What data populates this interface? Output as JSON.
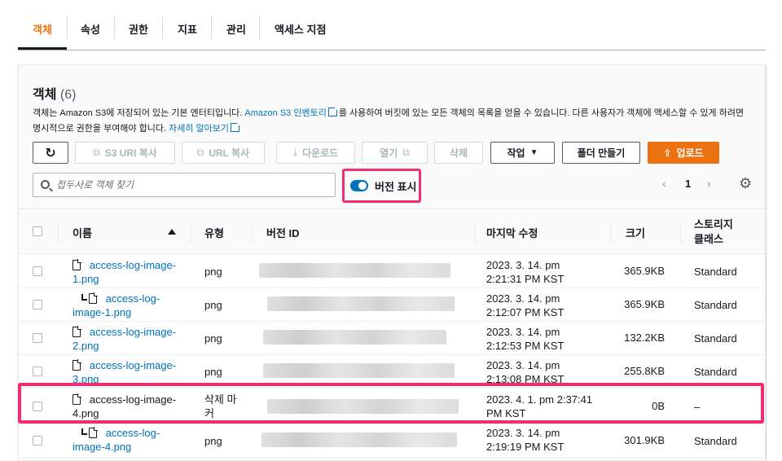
{
  "tabs": [
    {
      "label": "객체",
      "active": true
    },
    {
      "label": "속성",
      "active": false
    },
    {
      "label": "권한",
      "active": false
    },
    {
      "label": "지표",
      "active": false
    },
    {
      "label": "관리",
      "active": false
    },
    {
      "label": "액세스 지점",
      "active": false
    }
  ],
  "panel": {
    "title": "객체",
    "count": "(6)",
    "desc_part1": "객체는 Amazon S3에 저장되어 있는 기본 엔터티입니다. ",
    "desc_link1": "Amazon S3 인벤토리",
    "desc_part2": "를 사용하여 버킷에 있는 모든 객체의 목록을 얻을 수 있습니다. 다른 사용자가 객체에 액세스할 수 있게 하려면 명시적으로 권한을 부여해야 합니다. ",
    "desc_link2": "자세히 알아보기"
  },
  "toolbar": {
    "refresh_icon": "refresh-icon",
    "s3_uri_copy": "S3 URI 복사",
    "url_copy": "URL 복사",
    "download": "다운로드",
    "open": "열기",
    "delete": "삭제",
    "actions": "작업",
    "create_folder": "폴더 만들기",
    "upload": "업로드",
    "colors": {
      "primary": "#ec7211",
      "link": "#0073bb",
      "highlight": "#f02d6e"
    }
  },
  "search": {
    "placeholder": "접두사로 객체 찾기",
    "value": ""
  },
  "version_toggle": {
    "label": "버전 표시",
    "on": true
  },
  "pagination": {
    "prev": "‹",
    "page": "1",
    "next": "›"
  },
  "table": {
    "headers": {
      "name": "이름",
      "type": "유형",
      "version_id": "버전 ID",
      "modified": "마지막 수정",
      "size": "크기",
      "storage_l1": "스토리지",
      "storage_l2": "클래스"
    },
    "rows": [
      {
        "name_l1": "access-log-image-",
        "name_l2": "1.png",
        "type": "png",
        "modified_l1": "2023. 3. 14. pm",
        "modified_l2": "2:21:31 PM KST",
        "size": "365.9KB",
        "storage": "Standard",
        "child": false
      },
      {
        "name_l1": "access-log-",
        "name_l2": "image-1.png",
        "type": "png",
        "modified_l1": "2023. 3. 14. pm",
        "modified_l2": "2:12:07 PM KST",
        "size": "365.9KB",
        "storage": "Standard",
        "child": true
      },
      {
        "name_l1": "access-log-image-",
        "name_l2": "2.png",
        "type": "png",
        "modified_l1": "2023. 3. 14. pm",
        "modified_l2": "2:12:53 PM KST",
        "size": "132.2KB",
        "storage": "Standard",
        "child": false
      },
      {
        "name_l1": "access-log-image-",
        "name_l2": "3.png",
        "type": "png",
        "modified_l1": "2023. 3. 14. pm",
        "modified_l2": "2:13:08 PM KST",
        "size": "255.8KB",
        "storage": "Standard",
        "child": false
      },
      {
        "name_l1": "access-log-image-",
        "name_l2": "4.png",
        "type_l1": "삭제 마",
        "type_l2": "커",
        "modified_l1": "2023. 4. 1. pm 2:37:41",
        "modified_l2": "PM KST",
        "size": "0B",
        "storage": "–",
        "child": false,
        "delete_marker": true
      },
      {
        "name_l1": "access-log-",
        "name_l2": "image-4.png",
        "type": "png",
        "modified_l1": "2023. 3. 14. pm",
        "modified_l2": "2:19:19 PM KST",
        "size": "301.9KB",
        "storage": "Standard",
        "child": true
      }
    ]
  }
}
